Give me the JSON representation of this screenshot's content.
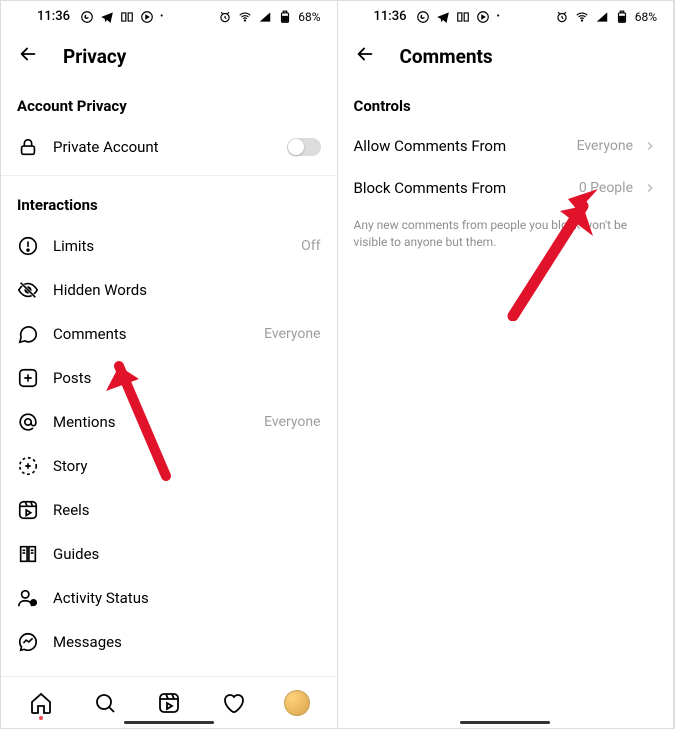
{
  "statusbar": {
    "time": "11:36",
    "battery": "68%"
  },
  "left": {
    "header": "Privacy",
    "sections": {
      "account_privacy": {
        "title": "Account Privacy",
        "private_account": "Private Account"
      },
      "interactions": {
        "title": "Interactions",
        "items": [
          {
            "label": "Limits",
            "value": "Off"
          },
          {
            "label": "Hidden Words",
            "value": ""
          },
          {
            "label": "Comments",
            "value": "Everyone"
          },
          {
            "label": "Posts",
            "value": ""
          },
          {
            "label": "Mentions",
            "value": "Everyone"
          },
          {
            "label": "Story",
            "value": ""
          },
          {
            "label": "Reels",
            "value": ""
          },
          {
            "label": "Guides",
            "value": ""
          },
          {
            "label": "Activity Status",
            "value": ""
          },
          {
            "label": "Messages",
            "value": ""
          }
        ]
      }
    }
  },
  "right": {
    "header": "Comments",
    "controls_title": "Controls",
    "rows": [
      {
        "label": "Allow Comments From",
        "value": "Everyone"
      },
      {
        "label": "Block Comments From",
        "value": "0 People"
      }
    ],
    "helper": "Any new comments from people you block won't be visible to anyone but them."
  }
}
